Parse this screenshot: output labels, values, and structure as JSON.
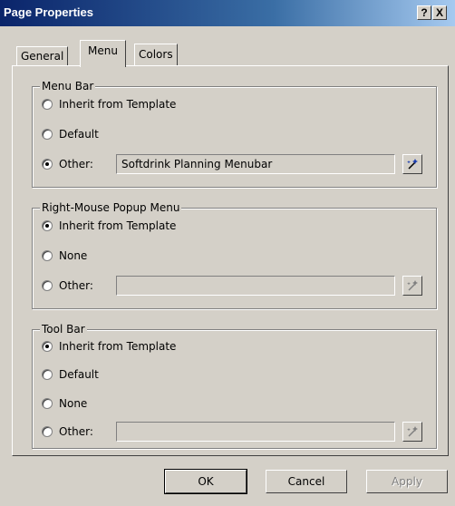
{
  "window": {
    "title": "Page Properties",
    "help_label": "?",
    "close_label": "X"
  },
  "tabs": [
    {
      "label": "General",
      "active": false
    },
    {
      "label": "Menu",
      "active": true
    },
    {
      "label": "Colors",
      "active": false
    }
  ],
  "menu_bar": {
    "legend": "Menu Bar",
    "options": [
      {
        "label": "Inherit from Template",
        "checked": false
      },
      {
        "label": "Default",
        "checked": false
      },
      {
        "label": "Other:",
        "checked": true
      }
    ],
    "other_value": "Softdrink Planning Menubar",
    "browse_icon": "wand-icon"
  },
  "popup_menu": {
    "legend": "Right-Mouse Popup Menu",
    "options": [
      {
        "label": "Inherit from Template",
        "checked": true
      },
      {
        "label": "None",
        "checked": false
      },
      {
        "label": "Other:",
        "checked": false
      }
    ],
    "other_value": "",
    "browse_icon": "wand-icon"
  },
  "tool_bar": {
    "legend": "Tool Bar",
    "options": [
      {
        "label": "Inherit from Template",
        "checked": true
      },
      {
        "label": "Default",
        "checked": false
      },
      {
        "label": "None",
        "checked": false
      },
      {
        "label": "Other:",
        "checked": false
      }
    ],
    "other_value": "",
    "browse_icon": "wand-icon"
  },
  "buttons": {
    "ok": "OK",
    "cancel": "Cancel",
    "apply": "Apply"
  },
  "colors": {
    "titlebar_start": "#0a246a",
    "titlebar_end": "#a6caf0",
    "face": "#d4d0c8"
  }
}
